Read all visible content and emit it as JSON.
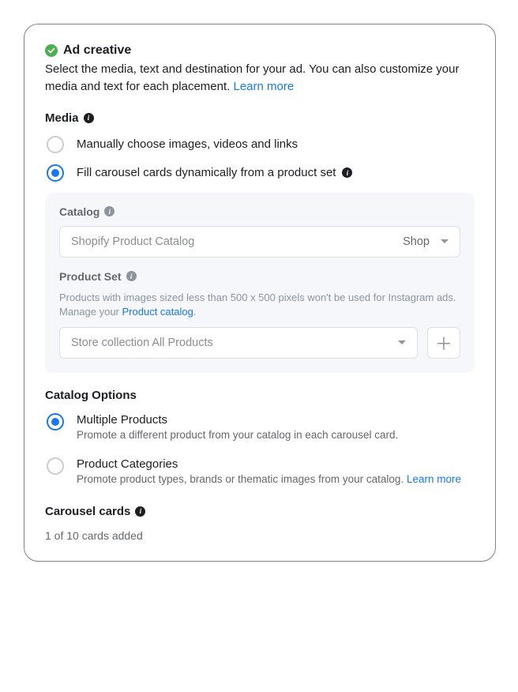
{
  "header": {
    "title": "Ad creative",
    "description": "Select the media, text and destination for your ad. You can also customize your media and text for each placement.",
    "learn_more": "Learn more"
  },
  "media": {
    "label": "Media",
    "options": {
      "manual": "Manually choose images, videos and links",
      "dynamic": "Fill carousel cards dynamically from a product set"
    }
  },
  "catalog": {
    "label": "Catalog",
    "selected": "Shopify Product Catalog",
    "badge": "Shop"
  },
  "product_set": {
    "label": "Product Set",
    "description_prefix": "Products with images sized less than 500 x 500 pixels won't be used for Instagram ads. Manage your ",
    "description_link": "Product catalog",
    "description_suffix": ".",
    "selected": "Store collection All Products"
  },
  "catalog_options": {
    "label": "Catalog Options",
    "multiple": {
      "title": "Multiple Products",
      "desc": "Promote a different product from your catalog in each carousel card."
    },
    "categories": {
      "title": "Product Categories",
      "desc_prefix": "Promote product types, brands or thematic images from your catalog. ",
      "learn_more": "Learn more"
    }
  },
  "carousel": {
    "label": "Carousel cards",
    "status": "1 of 10 cards added"
  }
}
